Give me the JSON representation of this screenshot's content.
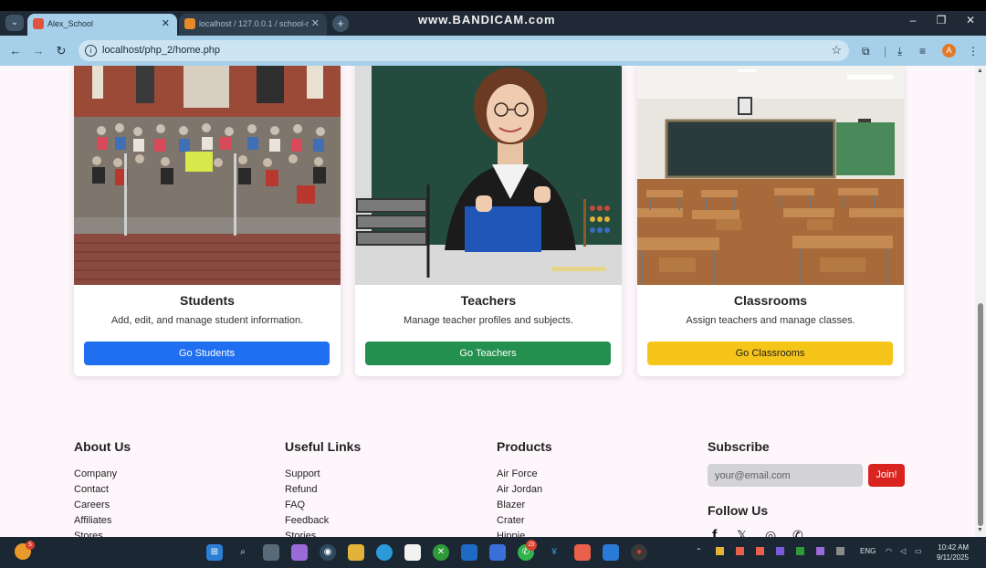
{
  "browser": {
    "tabs": [
      {
        "label": "Alex_School",
        "active": true
      },
      {
        "label": "localhost / 127.0.0.1 / school-r",
        "active": false
      }
    ],
    "recorder_brand": "www.BANDICAM.com",
    "url": "localhost/php_2/home.php",
    "profile_initial": "A"
  },
  "cards": [
    {
      "title": "Students",
      "description": "Add, edit, and manage student information.",
      "button": "Go Students",
      "color": "#1f6ff0",
      "text_color": "#ffffff"
    },
    {
      "title": "Teachers",
      "description": "Manage teacher profiles and subjects.",
      "button": "Go Teachers",
      "color": "#24904f",
      "text_color": "#ffffff"
    },
    {
      "title": "Classrooms",
      "description": "Assign teachers and manage classes.",
      "button": "Go Classrooms",
      "color": "#f6c51a",
      "text_color": "#1e1e1e"
    }
  ],
  "footer": {
    "about": {
      "heading": "About Us",
      "items": [
        "Company",
        "Contact",
        "Careers",
        "Affiliates",
        "Stores"
      ]
    },
    "links": {
      "heading": "Useful Links",
      "items": [
        "Support",
        "Refund",
        "FAQ",
        "Feedback",
        "Stories"
      ]
    },
    "products": {
      "heading": "Products",
      "items": [
        "Air Force",
        "Air Jordan",
        "Blazer",
        "Crater",
        "Hippie"
      ]
    },
    "subscribe": {
      "heading": "Subscribe",
      "placeholder": "your@email.com",
      "button": "Join!"
    },
    "follow": {
      "heading": "Follow Us",
      "icons": [
        "facebook-icon",
        "twitter-icon",
        "instagram-icon",
        "whatsapp-icon"
      ]
    }
  },
  "taskbar": {
    "whatsapp_badge": "23",
    "weather_badge": "5",
    "language": "ENG",
    "time": "10:42 AM",
    "date": "9/11/2025"
  }
}
